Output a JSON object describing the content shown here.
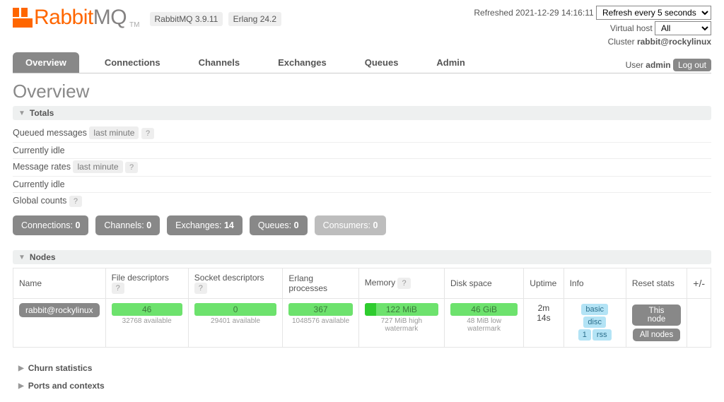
{
  "app": {
    "name_primary": "Rabbit",
    "name_secondary": "MQ",
    "tm": "TM",
    "version": "RabbitMQ 3.9.11",
    "erlang": "Erlang 24.2"
  },
  "status": {
    "refreshed_label": "Refreshed",
    "refreshed_time": "2021-12-29 14:16:11",
    "refresh_options": [
      "Refresh every 5 seconds"
    ],
    "refresh_selected": "Refresh every 5 seconds",
    "vhost_label": "Virtual host",
    "vhost_options": [
      "All"
    ],
    "vhost_selected": "All",
    "cluster_label": "Cluster",
    "cluster_value": "rabbit@rockylinux",
    "user_label": "User",
    "user_value": "admin",
    "logout": "Log out"
  },
  "tabs": [
    "Overview",
    "Connections",
    "Channels",
    "Exchanges",
    "Queues",
    "Admin"
  ],
  "tabs_active": "Overview",
  "page_title": "Overview",
  "sections": {
    "totals": {
      "title": "Totals",
      "queued_label": "Queued messages",
      "last_minute": "last minute",
      "idle1": "Currently idle",
      "rates_label": "Message rates",
      "idle2": "Currently idle",
      "global_label": "Global counts",
      "help": "?"
    },
    "counts": [
      {
        "label": "Connections:",
        "value": "0",
        "dim": false
      },
      {
        "label": "Channels:",
        "value": "0",
        "dim": false
      },
      {
        "label": "Exchanges:",
        "value": "14",
        "dim": false
      },
      {
        "label": "Queues:",
        "value": "0",
        "dim": false
      },
      {
        "label": "Consumers:",
        "value": "0",
        "dim": true
      }
    ],
    "nodes": {
      "title": "Nodes",
      "cols": [
        "Name",
        "File descriptors",
        "Socket descriptors",
        "Erlang processes",
        "Memory",
        "Disk space",
        "Uptime",
        "Info",
        "Reset stats"
      ],
      "help": "?",
      "pm": "+/-",
      "row": {
        "name": "rabbit@rockylinux",
        "fd": {
          "val": "46",
          "sub": "32768 available"
        },
        "sd": {
          "val": "0",
          "sub": "29401 available"
        },
        "ep": {
          "val": "367",
          "sub": "1048576 available"
        },
        "mem": {
          "val": "122 MiB",
          "sub": "727 MiB high watermark",
          "fill_pct": 16
        },
        "disk": {
          "val": "46 GiB",
          "sub": "48 MiB low watermark"
        },
        "uptime": "2m 14s",
        "info": [
          "basic",
          "disc",
          "1",
          "rss"
        ],
        "reset": [
          "This node",
          "All nodes"
        ]
      }
    },
    "churn": "Churn statistics",
    "ports": "Ports and contexts"
  }
}
